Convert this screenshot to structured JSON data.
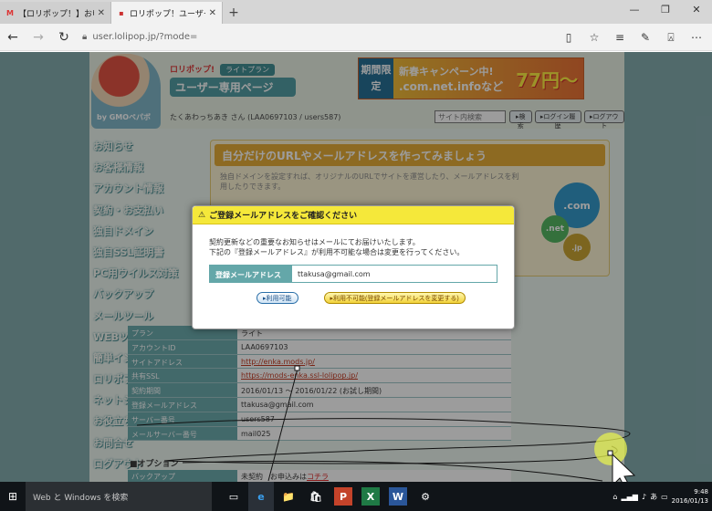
{
  "browser": {
    "tabs": [
      {
        "label": "【ロリポップ！】お申込み完了の",
        "favicon": "M",
        "active": false
      },
      {
        "label": "ロリポップ！ユーザー専用ペ",
        "favicon": "▪",
        "active": true
      }
    ],
    "url": "user.lolipop.jp/?mode="
  },
  "header": {
    "logo_top": "ロリポップ!",
    "plan_label": "ライトプラン",
    "logo_main": "ユーザー専用ページ",
    "mascot_badge": "by GMOペパボ",
    "campaign": {
      "kikan": "期間限定",
      "line1": "新春キャンペーン中!",
      "line2": ".com.net.infoなど",
      "price": "77円〜"
    },
    "user_line": "たくあわっちあき さん (LAA0697103 / users587)",
    "search_placeholder": "サイト内検索",
    "buttons": [
      "▸検索",
      "▸ログイン履歴",
      "▸ログアウト"
    ]
  },
  "sidebar": {
    "items": [
      "お知らせ",
      "お客様情報",
      "アカウント情報",
      "契約・お支払い",
      "独自ドメイン",
      "独自SSL証明書",
      "PC用ウイルス対策",
      "バックアップ",
      "メールツール",
      "WEBツール",
      "簡単インストール",
      "ロリポブログ",
      "ネットショップ作成",
      "お役立ちツール",
      "お問合せ",
      "ログアウト"
    ]
  },
  "panel": {
    "title": "自分だけのURLやメールアドレスを作ってみましょう",
    "text": "独自ドメインを設定すれば、オリジナルのURLでサイトを運営したり、メールアドレスを利用したりできます。",
    "domains": [
      ".com",
      ".net",
      ".jp"
    ]
  },
  "info": {
    "rows": [
      {
        "k": "プラン",
        "v": "ライト",
        "link": false
      },
      {
        "k": "アカウントID",
        "v": "LAA0697103",
        "link": false
      },
      {
        "k": "サイトアドレス",
        "v": "http://enka.mods.jp/",
        "link": true
      },
      {
        "k": "共有SSL",
        "v": "https://mods-enka.ssl-lolipop.jp/",
        "link": true
      },
      {
        "k": "契約期間",
        "v": "2016/01/13 ～ 2016/01/22 (お試し期間)",
        "link": false
      },
      {
        "k": "登録メールアドレス",
        "v": "ttakusa@gmail.com",
        "link": false
      },
      {
        "k": "サーバー番号",
        "v": "users587",
        "link": false
      },
      {
        "k": "メールサーバー番号",
        "v": "mail025",
        "link": false
      }
    ],
    "option_title": "■オプション",
    "option_row": {
      "k": "バックアップ",
      "v": "未契約",
      "v2": "お申込みは",
      "v3": "コチラ"
    }
  },
  "dialog": {
    "title": "ご登録メールアドレスをご確認ください",
    "msg1": "契約更新などの重要なお知らせはメールにてお届けいたします。",
    "msg2": "下記の『登録メールアドレス』が利用不可能な場合は変更を行ってください。",
    "field_label": "登録メールアドレス",
    "field_value": "ttakusa@gmail.com",
    "btn_ok": "▸利用可能",
    "btn_change": "▸利用不可能(登録メールアドレスを変更する)"
  },
  "taskbar": {
    "search": "Web と Windows を検索",
    "time": "9:48",
    "date": "2016/01/13",
    "apps": [
      "▭",
      "e",
      "📁",
      "🛍",
      "P",
      "X",
      "W",
      "⚙"
    ]
  },
  "colors": {
    "accent": "#64a7a9",
    "dialog_title": "#f5e83a",
    "panel_title": "#e5aa2d"
  }
}
